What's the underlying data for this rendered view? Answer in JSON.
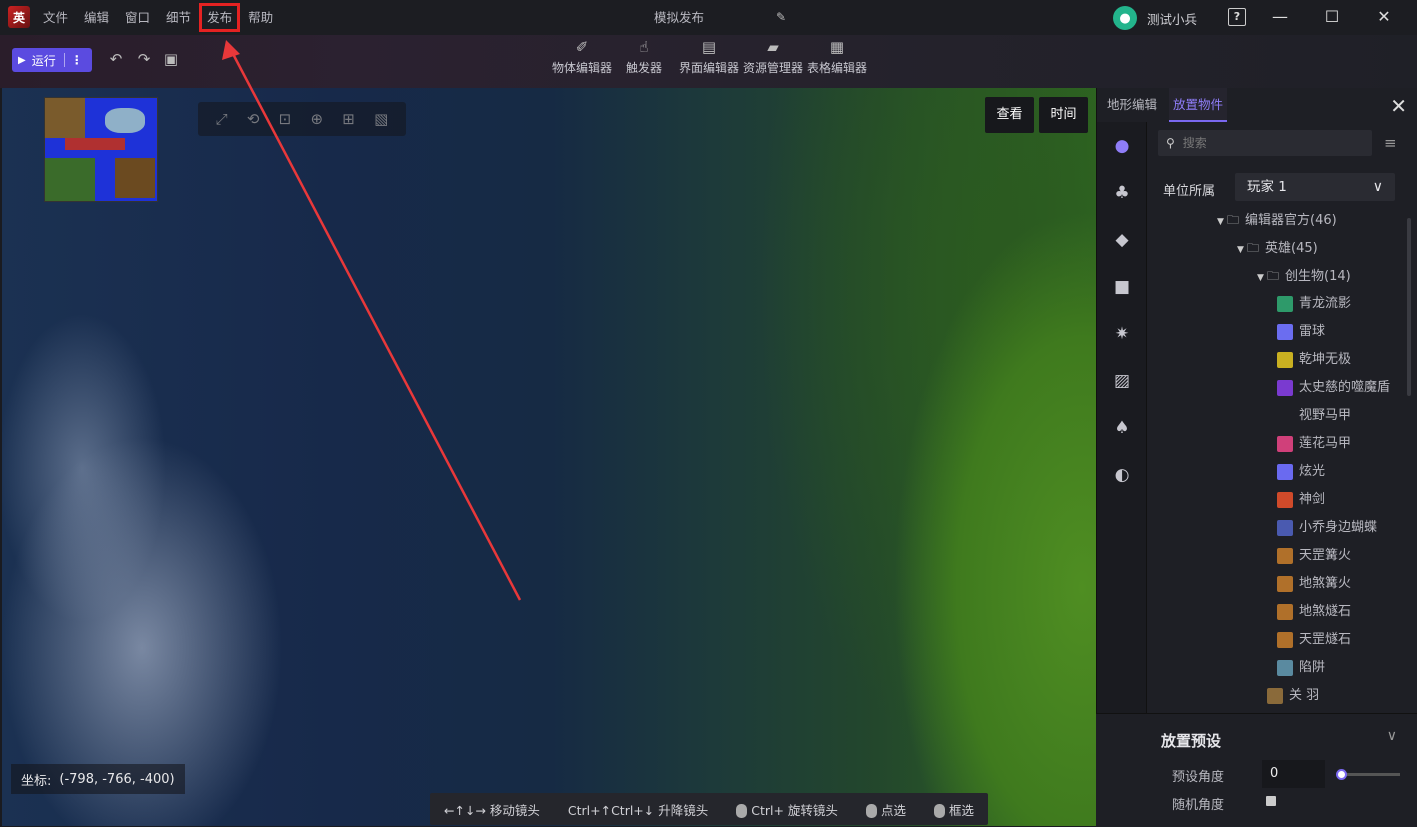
{
  "app": {
    "logo_text": "英",
    "center_title": "模拟发布",
    "user_name": "测试小兵"
  },
  "menu": [
    "文件",
    "编辑",
    "窗口",
    "细节",
    "发布",
    "帮助"
  ],
  "toolbar": {
    "run_label": "运行",
    "tools": [
      {
        "label": "物体编辑器",
        "icon": "pencil-icon"
      },
      {
        "label": "触发器",
        "icon": "hand-icon"
      },
      {
        "label": "界面编辑器",
        "icon": "layout-icon"
      },
      {
        "label": "资源管理器",
        "icon": "folder-icon"
      },
      {
        "label": "表格编辑器",
        "icon": "table-icon"
      }
    ]
  },
  "viewport": {
    "view_btn": "查看",
    "time_btn": "时间",
    "coord_label": "坐标:",
    "coord_value": "(-798, -766, -400)",
    "hints": [
      "←↑↓→ 移动镜头",
      "Ctrl+↑Ctrl+↓ 升降镜头",
      "Ctrl+ 旋转镜头",
      "点选",
      "框选"
    ]
  },
  "panel": {
    "tabs": [
      "地形编辑",
      "放置物件"
    ],
    "search_placeholder": "搜索",
    "owner_label": "单位所属",
    "owner_value": "玩家 1",
    "tree": [
      {
        "label": "编辑器官方(46)",
        "level": 0,
        "type": "folder"
      },
      {
        "label": "英雄(45)",
        "level": 1,
        "type": "folder"
      },
      {
        "label": "创生物(14)",
        "level": 2,
        "type": "folder"
      },
      {
        "label": "青龙流影",
        "level": 3,
        "color": "#2e9a6a"
      },
      {
        "label": "雷球",
        "level": 3,
        "color": "#6b6df0"
      },
      {
        "label": "乾坤无极",
        "level": 3,
        "color": "#c9b021"
      },
      {
        "label": "太史慈的噬魔盾",
        "level": 3,
        "color": "#7a3ad0"
      },
      {
        "label": "视野马甲",
        "level": 3,
        "color": ""
      },
      {
        "label": "莲花马甲",
        "level": 3,
        "color": "#d0407a"
      },
      {
        "label": "炫光",
        "level": 3,
        "color": "#6a6af0"
      },
      {
        "label": "神剑",
        "level": 3,
        "color": "#d04a2a"
      },
      {
        "label": "小乔身边蝴蝶",
        "level": 3,
        "color": "#4a5ab0"
      },
      {
        "label": "天罡篝火",
        "level": 3,
        "color": "#b0702a"
      },
      {
        "label": "地煞篝火",
        "level": 3,
        "color": "#b0702a"
      },
      {
        "label": "地煞燧石",
        "level": 3,
        "color": "#b0702a"
      },
      {
        "label": "天罡燧石",
        "level": 3,
        "color": "#b0702a"
      },
      {
        "label": "陷阱",
        "level": 3,
        "color": "#5a8aa0"
      },
      {
        "label": "关 羽",
        "level": 2,
        "color": "#8a6a3a"
      }
    ],
    "preset_title": "放置预设",
    "preset_angle_label": "预设角度",
    "preset_angle_value": "0",
    "random_angle_label": "随机角度"
  }
}
